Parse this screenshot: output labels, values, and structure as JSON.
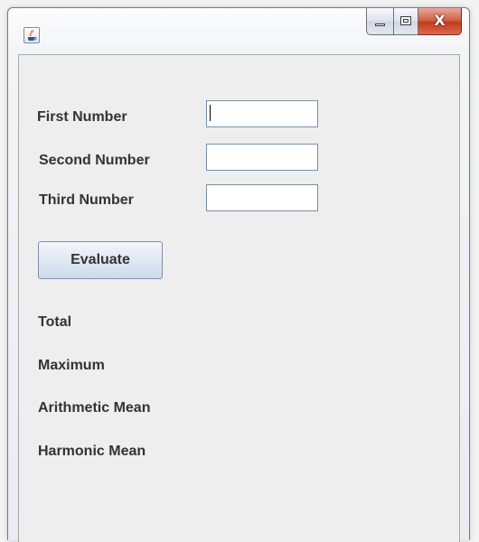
{
  "window": {
    "title": "",
    "app_icon": "java-icon",
    "minimize_icon": "minimize-icon",
    "maximize_icon": "maximize-icon",
    "close_icon": "close-icon",
    "close_glyph": "X"
  },
  "form": {
    "fields": [
      {
        "label": "First Number",
        "value": "",
        "focused": true
      },
      {
        "label": "Second Number",
        "value": ""
      },
      {
        "label": "Third Number",
        "value": ""
      }
    ],
    "evaluate_label": "Evaluate"
  },
  "results": [
    {
      "label": "Total"
    },
    {
      "label": "Maximum"
    },
    {
      "label": "Arithmetic Mean"
    },
    {
      "label": "Harmonic Mean"
    }
  ],
  "colors": {
    "close_button": "#c13b1d",
    "panel_background": "#eeeeee",
    "label_text": "#333333"
  }
}
